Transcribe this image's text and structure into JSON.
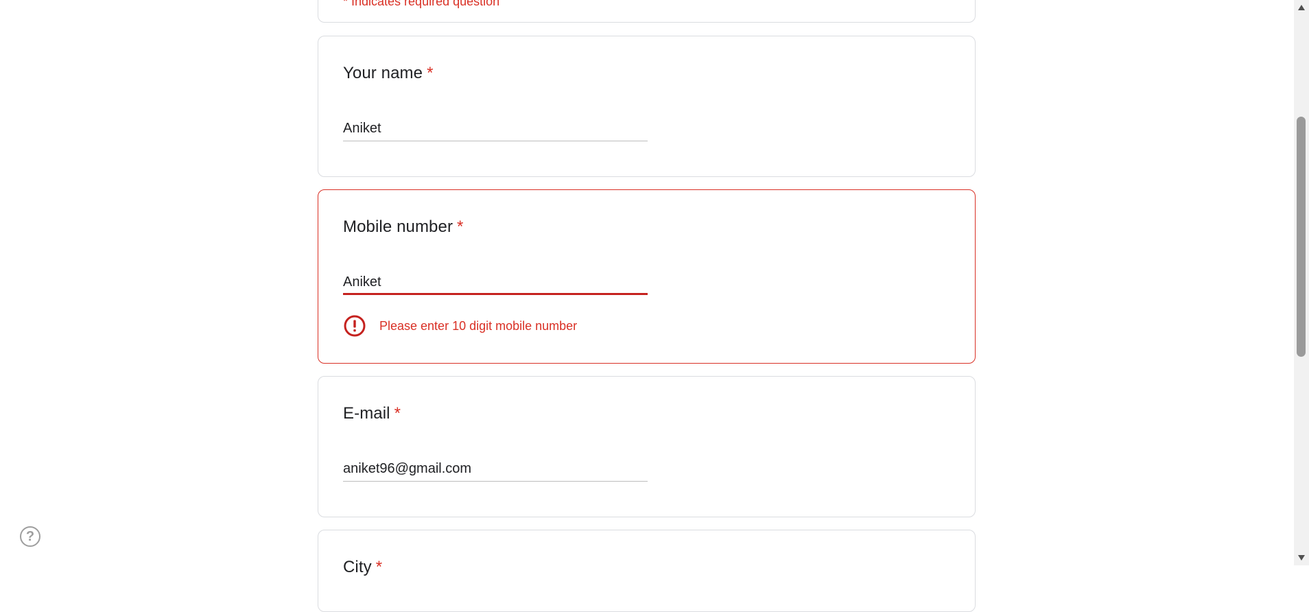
{
  "header_card": {
    "note": "* Indicates required question"
  },
  "questions": [
    {
      "title": "Your name",
      "required_mark": "*",
      "value": "Aniket"
    },
    {
      "title": "Mobile number",
      "required_mark": "*",
      "value": "Aniket",
      "error": "Please enter 10 digit mobile number"
    },
    {
      "title": "E-mail",
      "required_mark": "*",
      "value": "aniket96@gmail.com"
    },
    {
      "title": "City",
      "required_mark": "*"
    }
  ],
  "icons": {
    "error": "error-circle-icon",
    "help": "help-circle-icon",
    "scroll_up": "arrow-up-icon",
    "scroll_down": "arrow-down-icon"
  },
  "colors": {
    "error": "#d93025",
    "border": "#dadce0",
    "text": "#202124"
  }
}
